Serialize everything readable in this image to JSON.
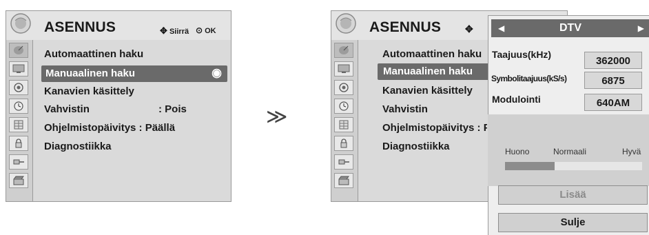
{
  "left_menu": {
    "title": "ASENNUS",
    "hint_move": "Siirrä",
    "hint_ok": "OK",
    "items": [
      {
        "label": "Automaattinen haku"
      },
      {
        "label": "Manuaalinen haku"
      },
      {
        "label": "Kanavien käsittely"
      },
      {
        "label": "Vahvistin",
        "value": ": Pois"
      },
      {
        "label": "Ohjelmistopäivitys : Päällä"
      },
      {
        "label": "Diagnostiikka"
      }
    ],
    "selected_index": 1
  },
  "arrow": "≫",
  "right_menu": {
    "title": "ASENNUS",
    "items": [
      {
        "label": "Automaattinen haku"
      },
      {
        "label": "Manuaalinen haku"
      },
      {
        "label": "Kanavien käsittely"
      },
      {
        "label": "Vahvistin"
      },
      {
        "label": "Ohjelmistopäivitys : P"
      },
      {
        "label": "Diagnostiikka"
      }
    ]
  },
  "popup": {
    "band": "DTV",
    "fields": [
      {
        "label": "Taajuus(kHz)",
        "value": "362000"
      },
      {
        "label": "Symbolitaajuus(kS/s)",
        "value": "6875"
      },
      {
        "label": "Modulointi",
        "value": "640AM"
      }
    ],
    "quality_labels": {
      "low": "Huono",
      "mid": "Normaali",
      "high": "Hyvä"
    },
    "quality_level": 0.36,
    "more_button": "Lisää",
    "close_button": "Sulje"
  },
  "icons": [
    "satellite-icon",
    "tv-screen-icon",
    "speaker-icon",
    "clock-icon",
    "lock-grid-icon",
    "padlock-icon",
    "connector-icon",
    "clapboard-icon"
  ]
}
